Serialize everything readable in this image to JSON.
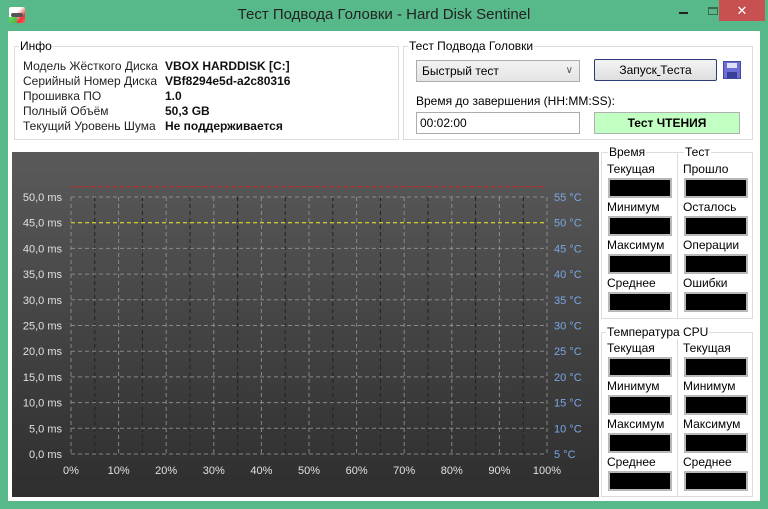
{
  "window": {
    "title": "Тест Подвода Головки - Hard Disk Sentinel",
    "controls": {
      "minimize": "–",
      "maximize": "□",
      "close": "✕"
    }
  },
  "info": {
    "group_label": "Инфо",
    "rows": [
      {
        "label": "Модель Жёсткого Диска",
        "value": "VBOX HARDDISK [C:]"
      },
      {
        "label": "Серийный Номер Диска",
        "value": "VBf8294e5d-a2c80316"
      },
      {
        "label": "Прошивка ПО",
        "value": "1.0"
      },
      {
        "label": "Полный Объём",
        "value": "50,3 GB"
      },
      {
        "label": "Текущий Уровень Шума",
        "value": "Не поддерживается"
      }
    ]
  },
  "test": {
    "group_label": "Тест Подвода Головки",
    "mode_selected": "Быстрый тест",
    "run_button": "Запуск Теста",
    "run_button_accel_index": 6,
    "save_icon": "save-icon",
    "time_label": "Время до завершения (HH:MM:SS):",
    "time_value": "00:02:00",
    "status": "Тест ЧТЕНИЯ",
    "status_color": "#c2ffc2"
  },
  "stats": {
    "time": {
      "label": "Время",
      "fields": [
        "Текущая",
        "Минимум",
        "Максимум",
        "Среднее"
      ]
    },
    "test": {
      "label": "Тест",
      "fields": [
        "Прошло",
        "Осталось",
        "Операции",
        "Ошибки"
      ]
    },
    "temperature": {
      "label": "Температура",
      "fields": [
        "Текущая",
        "Минимум",
        "Максимум",
        "Среднее"
      ]
    },
    "cpu": {
      "label": "CPU",
      "fields": [
        "Текущая",
        "Минимум",
        "Максимум",
        "Среднее"
      ]
    }
  },
  "chart_data": {
    "type": "line",
    "title": "",
    "xlabel": "",
    "ylabel": "ms",
    "y2label": "°C",
    "xlim": [
      0,
      100
    ],
    "ylim": [
      0,
      50
    ],
    "y2lim": [
      5,
      55
    ],
    "x_ticks": [
      "0%",
      "10%",
      "20%",
      "30%",
      "40%",
      "50%",
      "60%",
      "70%",
      "80%",
      "90%",
      "100%"
    ],
    "y_ticks": [
      "0,0 ms",
      "5,0 ms",
      "10,0 ms",
      "15,0 ms",
      "20,0 ms",
      "25,0 ms",
      "30,0 ms",
      "35,0 ms",
      "40,0 ms",
      "45,0 ms",
      "50,0 ms"
    ],
    "y2_ticks": [
      "5 °C",
      "10 °C",
      "15 °C",
      "20 °C",
      "25 °C",
      "30 °C",
      "35 °C",
      "40 °C",
      "45 °C",
      "50 °C",
      "55 °C"
    ],
    "grid": true,
    "reference_lines": [
      {
        "name": "critical-temperature",
        "axis": "y2",
        "value": 57,
        "color": "#e02020",
        "style": "dashed"
      },
      {
        "name": "warning-temperature",
        "axis": "y2",
        "value": 50,
        "color": "#e8e020",
        "style": "dashed"
      }
    ],
    "series": [],
    "colors": {
      "y_tick": "#e0e0e0",
      "y2_tick": "#7aa6e6",
      "x_tick": "#e0e0e0",
      "grid": "#9a9a9a",
      "minor_grid": "#222222"
    }
  }
}
